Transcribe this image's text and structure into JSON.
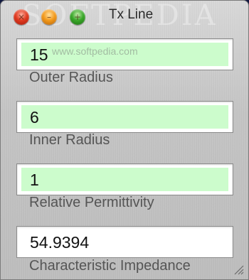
{
  "window": {
    "title": "Tx Line"
  },
  "watermark": {
    "big": "SOFTPEDIA",
    "small": "www.softpedia.com"
  },
  "fields": [
    {
      "value": "15",
      "label": "Outer Radius",
      "editable": true
    },
    {
      "value": "6",
      "label": "Inner Radius",
      "editable": true
    },
    {
      "value": "1",
      "label": "Relative Permittivity",
      "editable": true
    },
    {
      "value": "54.9394",
      "label": "Characteristic Impedance",
      "editable": false
    }
  ],
  "colors": {
    "input_fill": "#ccfccc",
    "output_fill": "#ffffff"
  }
}
